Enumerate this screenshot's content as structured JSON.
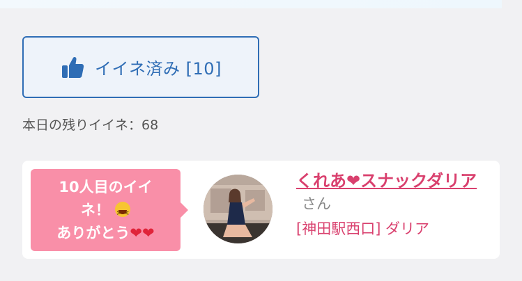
{
  "like_button": {
    "label": "イイネ済み [10]",
    "icon": "thumbs-up-icon",
    "color": "#2f6db5"
  },
  "remaining": {
    "text": "本日の残りイイネ：68"
  },
  "notice_card": {
    "bubble": {
      "line1": "10人目のイイ",
      "line2": "ネ！",
      "line3": "ありがとう",
      "emoji": "grinning-squinting-face-icon",
      "hearts": "❤❤",
      "color": "#f98fa8"
    },
    "avatar": "avatar",
    "name": "くれあ❤スナックダリア",
    "honorific": "さん",
    "shop": "[神田駅西口] ダリア",
    "accent_color": "#d9406e"
  }
}
